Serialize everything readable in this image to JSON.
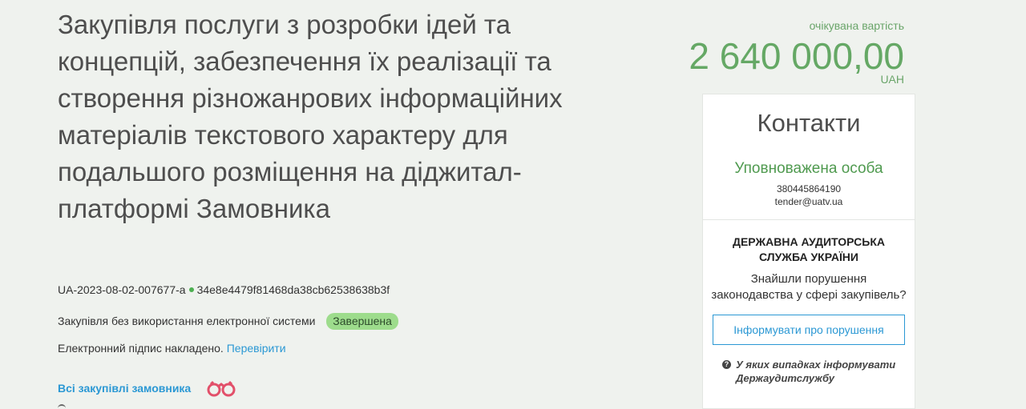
{
  "tender": {
    "title": "Закупівля послуги з розробки ідей та концепцій, забезпечення їх реалізації та створення різножанрових інформаційних матеріалів текстового характеру для подальшого розміщення на діджитал-платформі Замовника",
    "id": "UA-2023-08-02-007677-a",
    "hash": "34e8e4479f81468da38cb62538638b3f",
    "method": "Закупівля без використання електронної системи",
    "status": "Завершена",
    "signature_text": "Електронний підпис накладено.",
    "verify_link": "Перевірити",
    "all_tenders_link": "Всі закупівлі замовника"
  },
  "value": {
    "label": "очікувана вартість",
    "amount": "2 640 000,00",
    "currency": "UAH"
  },
  "contacts": {
    "title": "Контакти",
    "person": "Уповноважена особа",
    "phone": "380445864190",
    "email": "tender@uatv.ua"
  },
  "audit": {
    "title": "ДЕРЖАВНА АУДИТОРСЬКА СЛУЖБА УКРАЇНИ",
    "question": "Знайшли порушення законодавства у сфері закупівель?",
    "button": "Інформувати про порушення",
    "help": "У яких випадках інформувати Держаудитслужбу"
  },
  "icons": {
    "binoculars": "binoculars-icon",
    "help": "question-icon"
  },
  "colors": {
    "accent_green": "#65a865",
    "link_blue": "#2b98d4",
    "status_badge": "#9ddc8c",
    "background": "#eff2ee"
  }
}
